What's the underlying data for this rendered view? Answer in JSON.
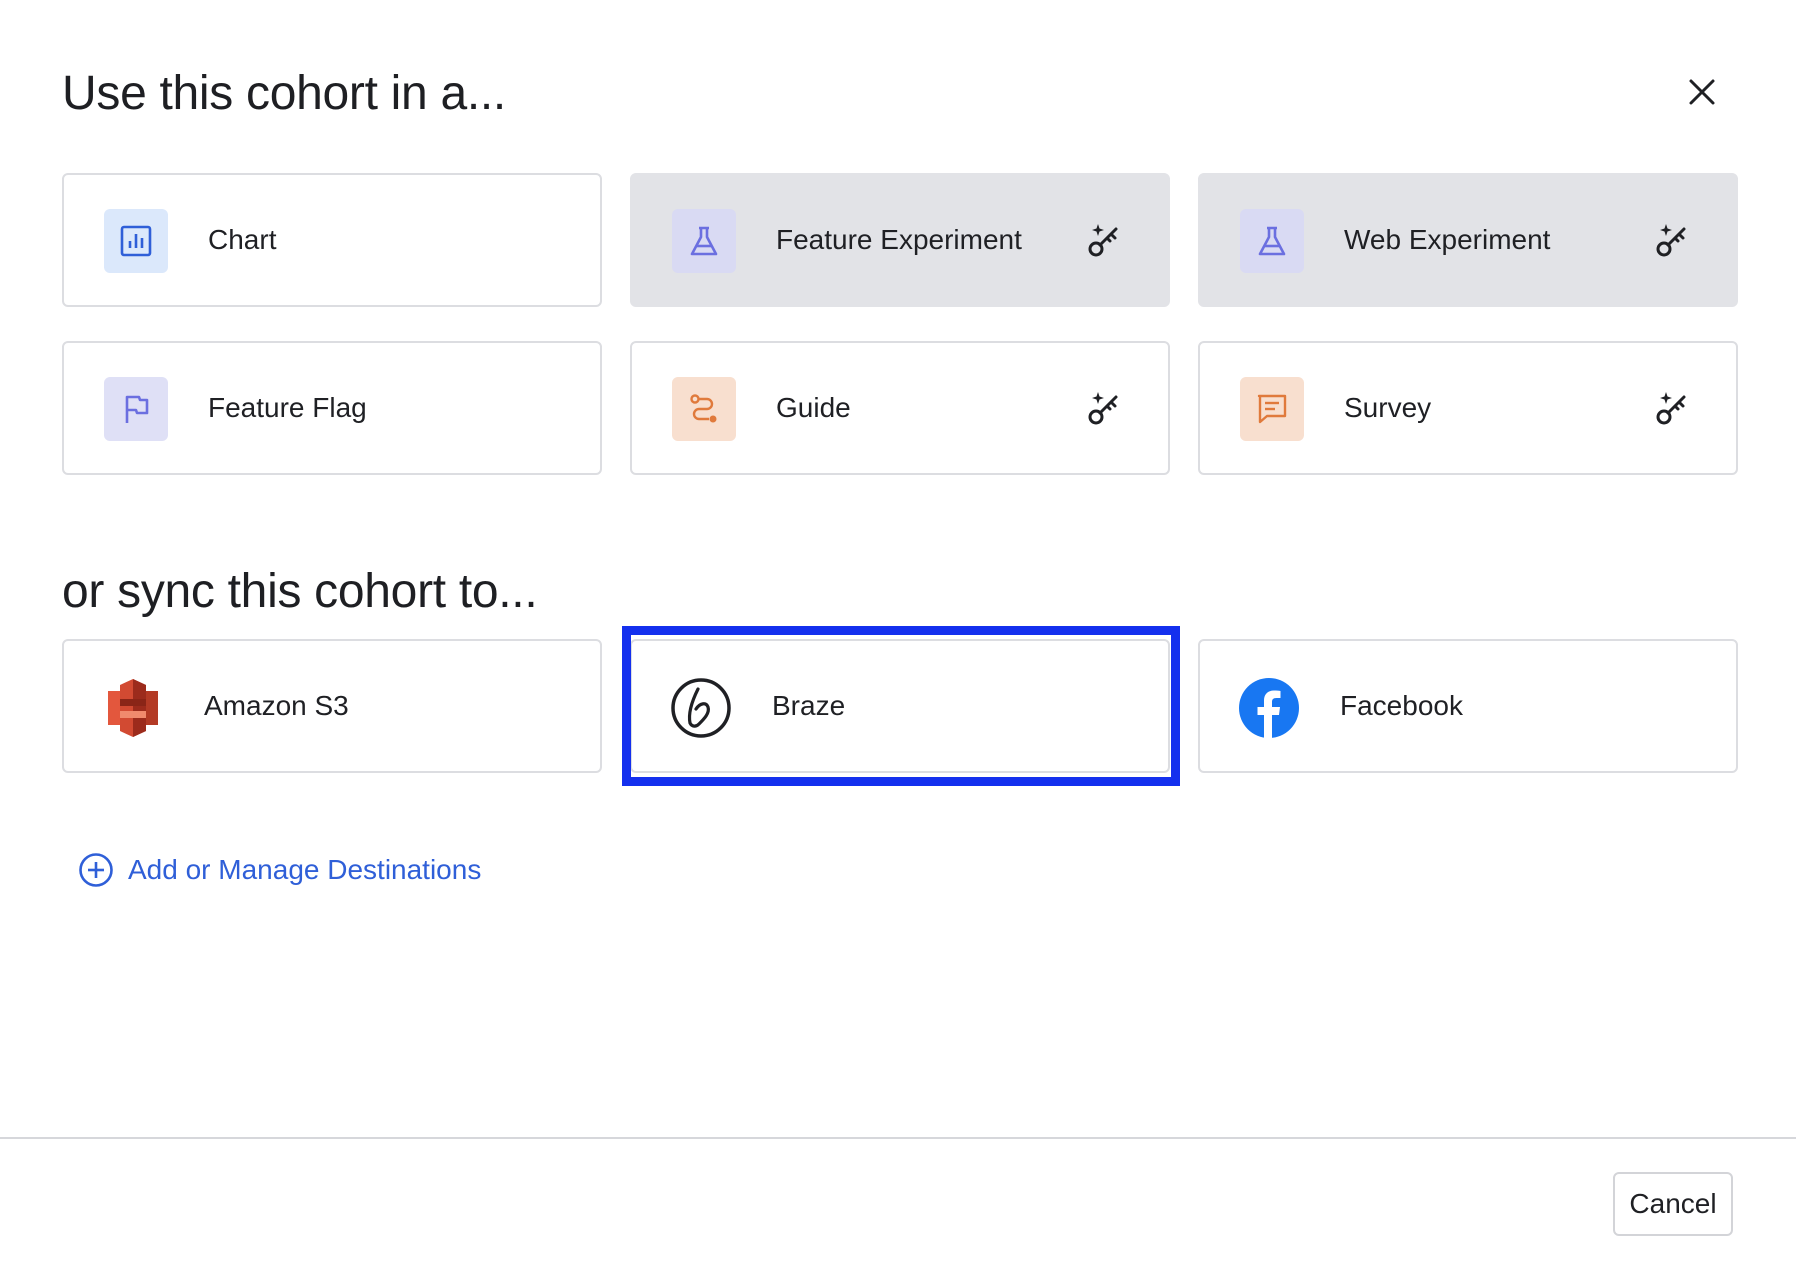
{
  "header": {
    "title": "Use this cohort in a..."
  },
  "use_cards": [
    {
      "label": "Chart",
      "icon": "chart-icon",
      "locked": false
    },
    {
      "label": "Feature Experiment",
      "icon": "flask-icon",
      "locked": true
    },
    {
      "label": "Web Experiment",
      "icon": "flask-icon",
      "locked": true
    },
    {
      "label": "Feature Flag",
      "icon": "flag-icon",
      "locked": false
    },
    {
      "label": "Guide",
      "icon": "route-icon",
      "locked": true
    },
    {
      "label": "Survey",
      "icon": "message-icon",
      "locked": true
    }
  ],
  "sync": {
    "title": "or sync this cohort to...",
    "destinations": [
      {
        "label": "Amazon S3",
        "icon": "amazon-s3-logo"
      },
      {
        "label": "Braze",
        "icon": "braze-logo",
        "highlighted": true
      },
      {
        "label": "Facebook",
        "icon": "facebook-logo"
      }
    ],
    "add_link": "Add or Manage Destinations"
  },
  "footer": {
    "cancel_label": "Cancel"
  },
  "colors": {
    "accent_blue": "#2f5fd8",
    "highlight": "#1430ee",
    "disabled_card": "#e2e3e7",
    "purple_icon": "#6b6fe0",
    "orange_icon": "#e07a3c"
  }
}
